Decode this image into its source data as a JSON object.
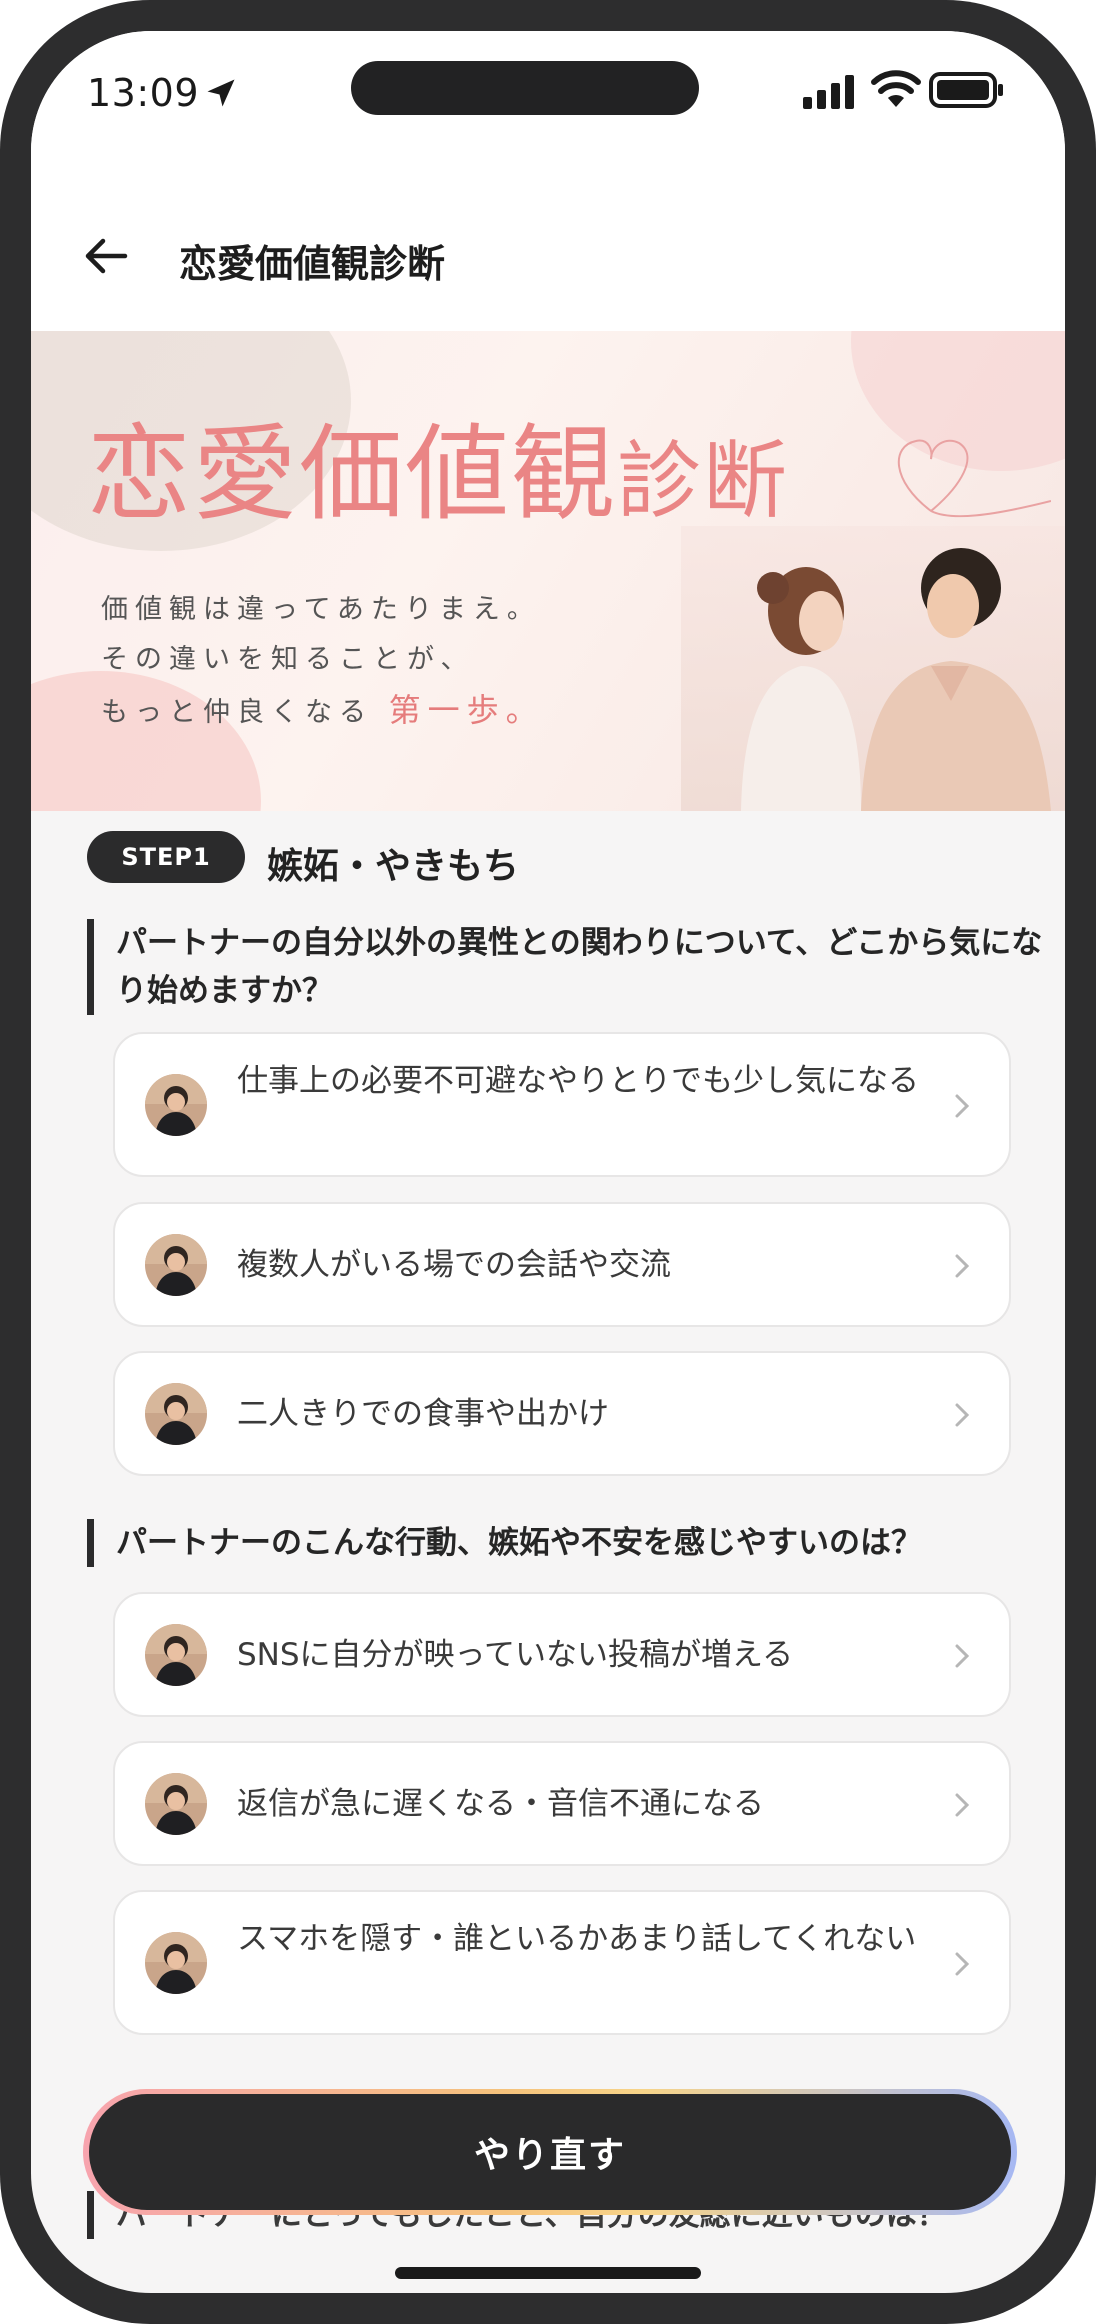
{
  "status_bar": {
    "time": "13:09"
  },
  "nav": {
    "title": "恋愛価値観診断"
  },
  "banner": {
    "title_main": "恋愛価値観",
    "title_sub": "診断",
    "copy_line1": "価値観は違ってあたりまえ。",
    "copy_line2": "その違いを知ることが、",
    "copy_line3_prefix": "もっと仲良くなる",
    "copy_line3_highlight": "第一歩。"
  },
  "step": {
    "badge": "STEP1",
    "title": "嫉妬・やきもち"
  },
  "questions": [
    {
      "text": "パートナーの自分以外の異性との関わりについて、どこから気になり始めますか？",
      "options": [
        "仕事上の必要不可避なやりとりでも少し気になる",
        "複数人がいる場での会話や交流",
        "二人きりでの食事や出かけ"
      ]
    },
    {
      "text": "パートナーのこんな行動、嫉妬や不安を感じやすいのは？",
      "options": [
        "SNSに自分が映っていない投稿が増える",
        "返信が急に遅くなる・音信不通になる",
        "スマホを隠す・誰といるかあまり話してくれない"
      ]
    },
    {
      "text": "パートナーにとってもしたこと、自分の友総に近いものは？"
    }
  ],
  "footer": {
    "redo_label": "やり直す"
  },
  "colors": {
    "accent_pink": "#ea8585",
    "dark": "#2b2b2c",
    "background": "#f6f5f5"
  },
  "icons": [
    "location-arrow-icon",
    "signal-icon",
    "wifi-icon",
    "battery-icon",
    "back-arrow-icon",
    "heart-outline-icon",
    "chevron-right-icon",
    "avatar"
  ]
}
